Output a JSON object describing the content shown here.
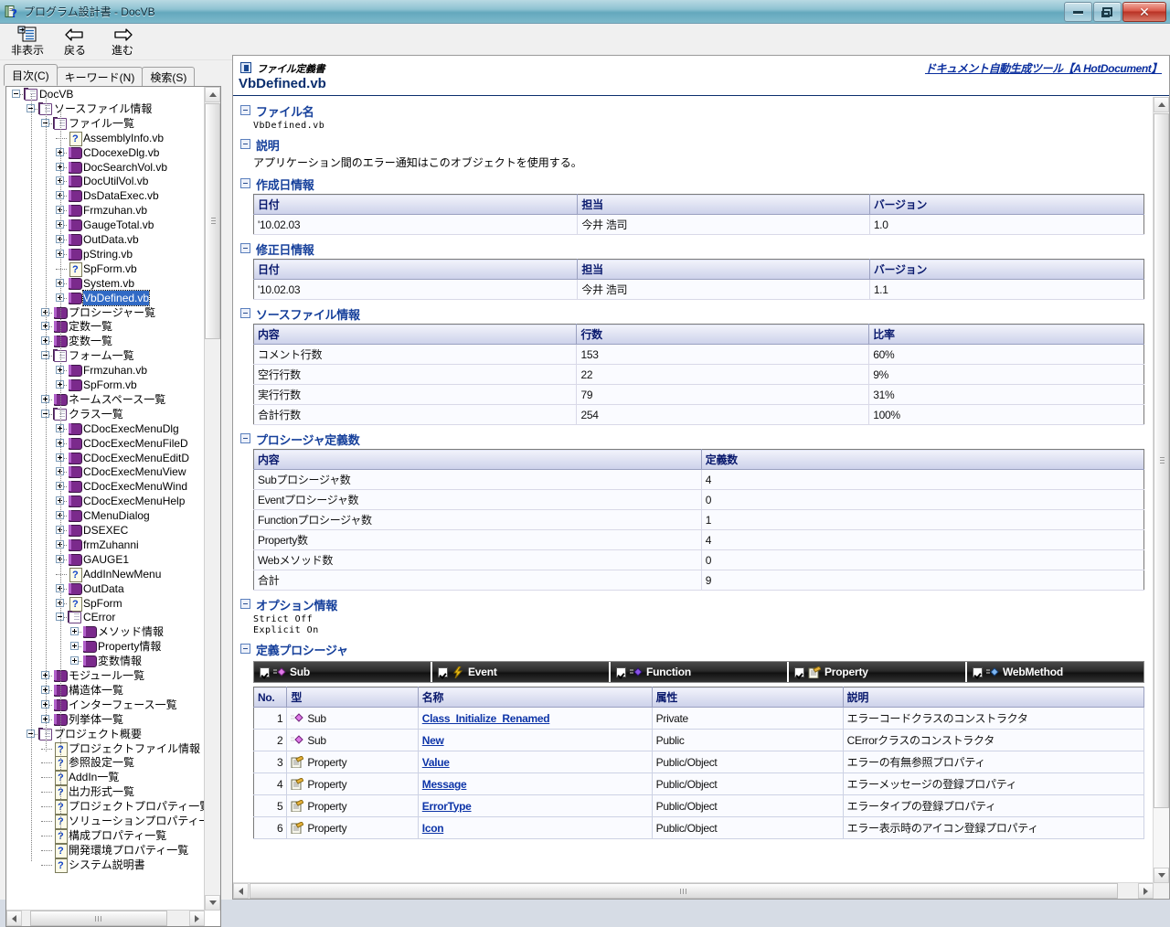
{
  "window": {
    "title": "プログラム設計書 - DocVB",
    "app_icon": "help-book-icon",
    "minimize_label": "最小化",
    "restore_label": "元のサイズに戻す",
    "close_label": "閉じる"
  },
  "toolbar": {
    "buttons": [
      {
        "label": "非表示",
        "icon": "hide-pane-icon"
      },
      {
        "label": "戻る",
        "icon": "back-arrow-icon"
      },
      {
        "label": "進む",
        "icon": "forward-arrow-icon"
      }
    ]
  },
  "left_pane": {
    "tabs": [
      {
        "label": "目次(C)",
        "mnemonic": "C",
        "active": true
      },
      {
        "label": "キーワード(N)",
        "mnemonic": "N",
        "active": false
      },
      {
        "label": "検索(S)",
        "mnemonic": "S",
        "active": false
      }
    ],
    "tree": [
      {
        "label": "DocVB",
        "depth": 0,
        "icon": "open-book-icon",
        "toggle": "minus"
      },
      {
        "label": "ソースファイル情報",
        "depth": 1,
        "icon": "open-book-icon",
        "toggle": "minus"
      },
      {
        "label": "ファイル一覧",
        "depth": 2,
        "icon": "open-book-icon",
        "toggle": "minus"
      },
      {
        "label": "AssemblyInfo.vb",
        "depth": 3,
        "icon": "question-page-icon",
        "toggle": "none"
      },
      {
        "label": "CDocexeDlg.vb",
        "depth": 3,
        "icon": "book-icon",
        "toggle": "plus"
      },
      {
        "label": "DocSearchVol.vb",
        "depth": 3,
        "icon": "book-icon",
        "toggle": "plus"
      },
      {
        "label": "DocUtilVol.vb",
        "depth": 3,
        "icon": "book-icon",
        "toggle": "plus"
      },
      {
        "label": "DsDataExec.vb",
        "depth": 3,
        "icon": "book-icon",
        "toggle": "plus"
      },
      {
        "label": "Frmzuhan.vb",
        "depth": 3,
        "icon": "book-icon",
        "toggle": "plus"
      },
      {
        "label": "GaugeTotal.vb",
        "depth": 3,
        "icon": "book-icon",
        "toggle": "plus"
      },
      {
        "label": "OutData.vb",
        "depth": 3,
        "icon": "book-icon",
        "toggle": "plus"
      },
      {
        "label": "pString.vb",
        "depth": 3,
        "icon": "book-icon",
        "toggle": "plus"
      },
      {
        "label": "SpForm.vb",
        "depth": 3,
        "icon": "question-page-icon",
        "toggle": "none"
      },
      {
        "label": "System.vb",
        "depth": 3,
        "icon": "book-icon",
        "toggle": "plus"
      },
      {
        "label": "VbDefined.vb",
        "depth": 3,
        "icon": "book-icon",
        "toggle": "plus",
        "selected": true
      },
      {
        "label": "プロシージャー覧",
        "depth": 2,
        "icon": "book-icon",
        "toggle": "plus"
      },
      {
        "label": "定数一覧",
        "depth": 2,
        "icon": "book-icon",
        "toggle": "plus"
      },
      {
        "label": "変数一覧",
        "depth": 2,
        "icon": "book-icon",
        "toggle": "plus"
      },
      {
        "label": "フォーム一覧",
        "depth": 2,
        "icon": "open-book-icon",
        "toggle": "minus"
      },
      {
        "label": "Frmzuhan.vb",
        "depth": 3,
        "icon": "book-icon",
        "toggle": "plus"
      },
      {
        "label": "SpForm.vb",
        "depth": 3,
        "icon": "book-icon",
        "toggle": "plus"
      },
      {
        "label": "ネームスペース一覧",
        "depth": 2,
        "icon": "book-icon",
        "toggle": "plus"
      },
      {
        "label": "クラス一覧",
        "depth": 2,
        "icon": "open-book-icon",
        "toggle": "minus"
      },
      {
        "label": "CDocExecMenuDlg",
        "depth": 3,
        "icon": "book-icon",
        "toggle": "plus"
      },
      {
        "label": "CDocExecMenuFileD",
        "depth": 3,
        "icon": "book-icon",
        "toggle": "plus"
      },
      {
        "label": "CDocExecMenuEditD",
        "depth": 3,
        "icon": "book-icon",
        "toggle": "plus"
      },
      {
        "label": "CDocExecMenuView",
        "depth": 3,
        "icon": "book-icon",
        "toggle": "plus"
      },
      {
        "label": "CDocExecMenuWind",
        "depth": 3,
        "icon": "book-icon",
        "toggle": "plus"
      },
      {
        "label": "CDocExecMenuHelp",
        "depth": 3,
        "icon": "book-icon",
        "toggle": "plus"
      },
      {
        "label": "CMenuDialog",
        "depth": 3,
        "icon": "book-icon",
        "toggle": "plus"
      },
      {
        "label": "DSEXEC",
        "depth": 3,
        "icon": "book-icon",
        "toggle": "plus"
      },
      {
        "label": "frmZuhanni",
        "depth": 3,
        "icon": "book-icon",
        "toggle": "plus"
      },
      {
        "label": "GAUGE1",
        "depth": 3,
        "icon": "book-icon",
        "toggle": "plus"
      },
      {
        "label": "AddInNewMenu",
        "depth": 3,
        "icon": "question-page-icon",
        "toggle": "none"
      },
      {
        "label": "OutData",
        "depth": 3,
        "icon": "book-icon",
        "toggle": "plus"
      },
      {
        "label": "SpForm",
        "depth": 3,
        "icon": "question-page-icon",
        "toggle": "plus"
      },
      {
        "label": "CError",
        "depth": 3,
        "icon": "open-book-icon",
        "toggle": "minus"
      },
      {
        "label": "メソッド情報",
        "depth": 4,
        "icon": "book-icon",
        "toggle": "plus"
      },
      {
        "label": "Property情報",
        "depth": 4,
        "icon": "book-icon",
        "toggle": "plus"
      },
      {
        "label": "変数情報",
        "depth": 4,
        "icon": "book-icon",
        "toggle": "plus"
      },
      {
        "label": "モジュール一覧",
        "depth": 2,
        "icon": "book-icon",
        "toggle": "plus"
      },
      {
        "label": "構造体一覧",
        "depth": 2,
        "icon": "book-icon",
        "toggle": "plus"
      },
      {
        "label": "インターフェース一覧",
        "depth": 2,
        "icon": "book-icon",
        "toggle": "plus"
      },
      {
        "label": "列挙体一覧",
        "depth": 2,
        "icon": "book-icon",
        "toggle": "plus"
      },
      {
        "label": "プロジェクト概要",
        "depth": 1,
        "icon": "open-book-icon",
        "toggle": "minus"
      },
      {
        "label": "プロジェクトファイル情報",
        "depth": 2,
        "icon": "question-page-icon",
        "toggle": "none"
      },
      {
        "label": "参照設定一覧",
        "depth": 2,
        "icon": "question-page-icon",
        "toggle": "none"
      },
      {
        "label": "AddIn一覧",
        "depth": 2,
        "icon": "question-page-icon",
        "toggle": "none"
      },
      {
        "label": "出力形式一覧",
        "depth": 2,
        "icon": "question-page-icon",
        "toggle": "none"
      },
      {
        "label": "プロジェクトプロパティ一覧",
        "depth": 2,
        "icon": "question-page-icon",
        "toggle": "none"
      },
      {
        "label": "ソリューションプロパティ一覧",
        "depth": 2,
        "icon": "question-page-icon",
        "toggle": "none"
      },
      {
        "label": "構成プロパティ一覧",
        "depth": 2,
        "icon": "question-page-icon",
        "toggle": "none"
      },
      {
        "label": "開発環境プロパティ一覧",
        "depth": 2,
        "icon": "question-page-icon",
        "toggle": "none"
      },
      {
        "label": "システム説明書",
        "depth": 2,
        "icon": "question-page-icon",
        "toggle": "none"
      }
    ]
  },
  "document": {
    "header": {
      "kind_label": "ファイル定義書",
      "brand_link": "ドキュメント自動生成ツール【A HotDocument】",
      "title": "VbDefined.vb"
    },
    "sections": {
      "filename": {
        "title": "ファイル名",
        "value": "VbDefined.vb"
      },
      "description": {
        "title": "説明",
        "value": "アプリケーション間のエラー通知はこのオブジェクトを使用する。"
      },
      "created": {
        "title": "作成日情報",
        "columns": [
          "日付",
          "担当",
          "バージョン"
        ],
        "rows": [
          [
            "'10.02.03",
            "今井 浩司",
            "1.0"
          ]
        ]
      },
      "modified": {
        "title": "修正日情報",
        "columns": [
          "日付",
          "担当",
          "バージョン"
        ],
        "rows": [
          [
            "'10.02.03",
            "今井 浩司",
            "1.1"
          ]
        ]
      },
      "source_info": {
        "title": "ソースファイル情報",
        "columns": [
          "内容",
          "行数",
          "比率"
        ],
        "rows": [
          [
            "コメント行数",
            "153",
            "60%"
          ],
          [
            "空行行数",
            "22",
            "9%"
          ],
          [
            "実行行数",
            "79",
            "31%"
          ],
          [
            "合計行数",
            "254",
            "100%"
          ]
        ]
      },
      "proc_counts": {
        "title": "プロシージャ定義数",
        "columns": [
          "内容",
          "定義数"
        ],
        "rows": [
          [
            "Subプロシージャ数",
            "4"
          ],
          [
            "Eventプロシージャ数",
            "0"
          ],
          [
            "Functionプロシージャ数",
            "1"
          ],
          [
            "Property数",
            "4"
          ],
          [
            "Webメソッド数",
            "0"
          ],
          [
            "合計",
            "9"
          ]
        ]
      },
      "options": {
        "title": "オプション情報",
        "lines": [
          "Strict Off",
          "Explicit On"
        ]
      },
      "procedures": {
        "title": "定義プロシージャ",
        "filter_tabs": [
          {
            "label": "Sub",
            "checked": true,
            "icon": "sub-glyph-icon"
          },
          {
            "label": "Event",
            "checked": true,
            "icon": "event-glyph-icon"
          },
          {
            "label": "Function",
            "checked": true,
            "icon": "function-glyph-icon"
          },
          {
            "label": "Property",
            "checked": true,
            "icon": "property-glyph-icon"
          },
          {
            "label": "WebMethod",
            "checked": true,
            "icon": "webmethod-glyph-icon"
          }
        ],
        "columns": [
          "No.",
          "型",
          "名称",
          "属性",
          "説明"
        ],
        "rows": [
          {
            "no": "1",
            "type": "Sub",
            "type_icon": "sub-glyph-icon",
            "name": "Class_Initialize_Renamed",
            "attr": "Private",
            "desc": "エラーコードクラスのコンストラクタ"
          },
          {
            "no": "2",
            "type": "Sub",
            "type_icon": "sub-glyph-icon",
            "name": "New",
            "attr": "Public",
            "desc": "CErrorクラスのコンストラクタ"
          },
          {
            "no": "3",
            "type": "Property",
            "type_icon": "property-glyph-icon",
            "name": "Value",
            "attr": "Public/Object",
            "desc": "エラーの有無参照プロパティ"
          },
          {
            "no": "4",
            "type": "Property",
            "type_icon": "property-glyph-icon",
            "name": "Message",
            "attr": "Public/Object",
            "desc": "エラーメッセージの登録プロパティ"
          },
          {
            "no": "5",
            "type": "Property",
            "type_icon": "property-glyph-icon",
            "name": "ErrorType",
            "attr": "Public/Object",
            "desc": "エラータイプの登録プロパティ"
          },
          {
            "no": "6",
            "type": "Property",
            "type_icon": "property-glyph-icon",
            "name": "Icon",
            "attr": "Public/Object",
            "desc": "エラー表示時のアイコン登録プロパティ"
          }
        ]
      }
    }
  },
  "colors": {
    "title_accent": "#64a8bd",
    "section_heading": "#16409b",
    "link": "#0e35a8",
    "table_header_text": "#0a1a6e",
    "tree_selection": "#316ac5"
  }
}
